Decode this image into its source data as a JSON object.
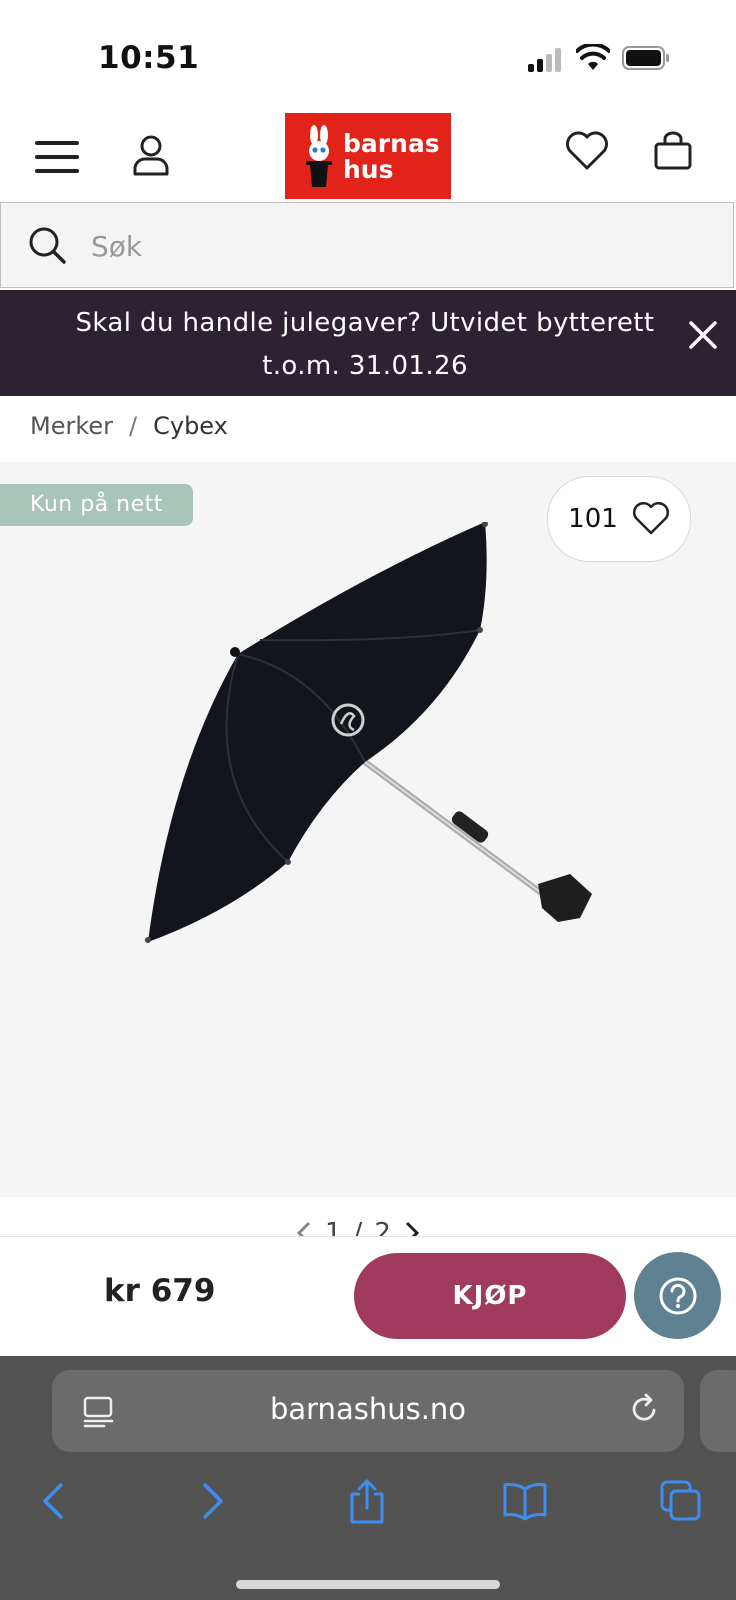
{
  "status_bar": {
    "time": "10:51"
  },
  "header": {
    "logo_line1": "barnas",
    "logo_line2": "hus",
    "brand_color": "#e2231a",
    "icons": [
      "menu-icon",
      "account-icon",
      "wishlist-icon",
      "cart-icon"
    ]
  },
  "search": {
    "placeholder": "Søk"
  },
  "promo": {
    "text": "Skal du handle julegaver? Utvidet bytterett t.o.m. 31.01.26",
    "background": "#2c2231"
  },
  "breadcrumb": {
    "items": [
      "Merker",
      "Cybex"
    ],
    "separator": "/"
  },
  "gallery": {
    "badge": "Kun på nett",
    "like_count": "101",
    "image_alt": "black stroller parasol umbrella",
    "pager_current": "1",
    "pager_separator": "/",
    "pager_total": "2"
  },
  "buybar": {
    "price": "kr 679",
    "buy_label": "KJØP",
    "buy_color": "#a03a5e",
    "help_color": "#5f8293"
  },
  "browser": {
    "url": "barnashus.no",
    "toolbar_icons": [
      "back-icon",
      "forward-icon",
      "share-icon",
      "bookmarks-icon",
      "tabs-icon"
    ]
  }
}
